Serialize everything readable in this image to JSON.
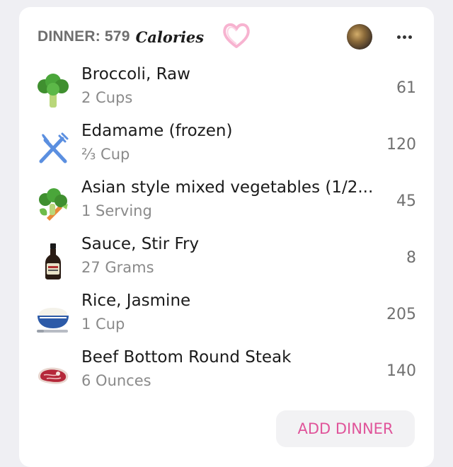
{
  "header": {
    "meal_label": "DINNER: 579",
    "calories_word": "Calories"
  },
  "items": [
    {
      "name": "Broccoli, Raw",
      "qty": "2 Cups",
      "cal": "61",
      "icon": "broccoli-icon"
    },
    {
      "name": "Edamame (frozen)",
      "qty": "⅔ Cup",
      "cal": "120",
      "icon": "fork-knife-icon"
    },
    {
      "name": "Asian style mixed vegetables (1/2...",
      "qty": "1 Serving",
      "cal": "45",
      "icon": "mixed-vegetables-icon"
    },
    {
      "name": "Sauce, Stir Fry",
      "qty": "27 Grams",
      "cal": "8",
      "icon": "sauce-bottle-icon"
    },
    {
      "name": "Rice, Jasmine",
      "qty": "1 Cup",
      "cal": "205",
      "icon": "rice-bowl-icon"
    },
    {
      "name": "Beef Bottom Round Steak",
      "qty": "6 Ounces",
      "cal": "140",
      "icon": "steak-icon"
    }
  ],
  "actions": {
    "add_label": "ADD DINNER"
  },
  "colors": {
    "accent": "#e0549a",
    "heart": "#f7b3d0",
    "fork_knife": "#5b8fe0"
  }
}
